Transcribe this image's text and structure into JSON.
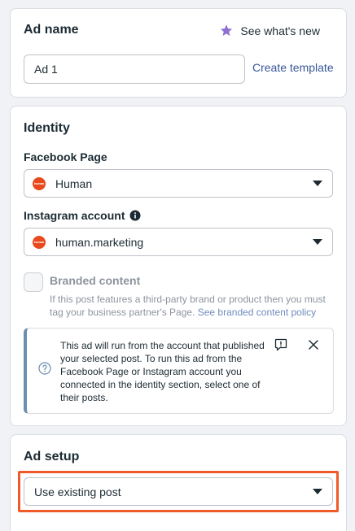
{
  "ad_name_section": {
    "title": "Ad name",
    "whats_new": "See what's new",
    "ad_name_value": "Ad 1",
    "create_template": "Create template"
  },
  "identity": {
    "title": "Identity",
    "facebook_page_label": "Facebook Page",
    "facebook_page_value": "Human",
    "instagram_label": "Instagram account",
    "instagram_value": "human.marketing",
    "brand_logo_text": "human",
    "branded_content_label": "Branded content",
    "branded_content_desc": "If this post features a third-party brand or product then you must tag your business partner's Page. ",
    "branded_content_link": "See branded content policy",
    "info_message": "This ad will run from the account that published your selected post. To run this ad from the Facebook Page or Instagram account you connected in the identity section, select one of their posts."
  },
  "ad_setup": {
    "title": "Ad setup",
    "selected_option": "Use existing post"
  },
  "colors": {
    "accent_link": "#385898",
    "brand_orange": "#e8491d",
    "highlight": "#f05a28",
    "star": "#8c6fd1"
  },
  "icons": [
    "star-icon",
    "info-circle-icon",
    "caret-down-icon",
    "question-circle-icon",
    "feedback-icon",
    "close-icon"
  ]
}
